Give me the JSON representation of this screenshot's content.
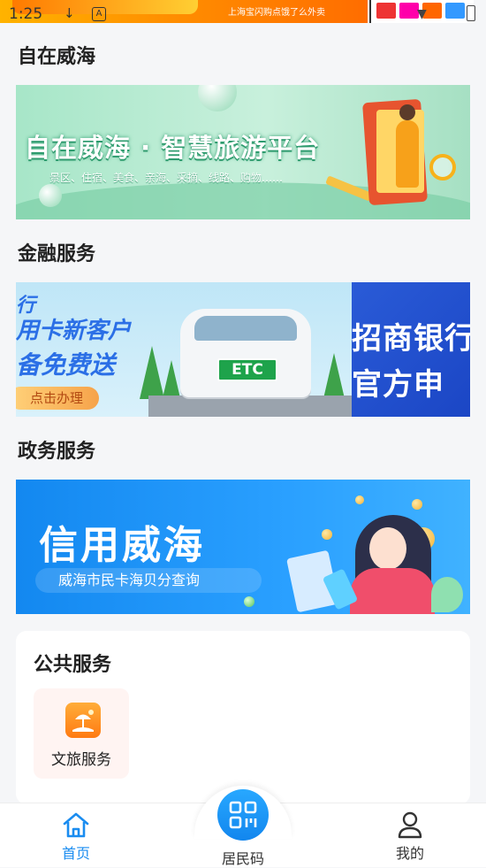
{
  "status_bar": {
    "time": "1:25",
    "download_glyph": "↓",
    "a_glyph": "A"
  },
  "top_ad": {
    "text": "上海宝闪购点饿了么外卖"
  },
  "sections": {
    "ziwai": {
      "title": "自在威海",
      "banner_title": "自在威海 · 智慧旅游平台",
      "banner_subtitle": "景区、住宿、美食、亲海、采摘、线路、购物……"
    },
    "finance": {
      "title": "金融服务",
      "banner_left_line1": "行",
      "banner_left_line2": "用卡新客户",
      "banner_left_line3": "备免费送",
      "banner_button": "点击办理",
      "banner_etc": "ETC",
      "banner_right_line1": "招商银行",
      "banner_right_line2": "官方申"
    },
    "government": {
      "title": "政务服务",
      "banner_title": "信用威海",
      "banner_subtitle": "威海市民卡海贝分查询"
    }
  },
  "public_services": {
    "title": "公共服务",
    "items": [
      {
        "label": "文旅服务",
        "icon": "beach-umbrella-icon"
      }
    ]
  },
  "bottom_nav": {
    "home_label": "首页",
    "center_label": "居民码",
    "mine_label": "我的"
  },
  "colors": {
    "accent": "#1a8cf0",
    "page_bg": "#f5f6f8",
    "tile_bg": "#fff4f2",
    "service_icon": "#ff8a1f"
  }
}
